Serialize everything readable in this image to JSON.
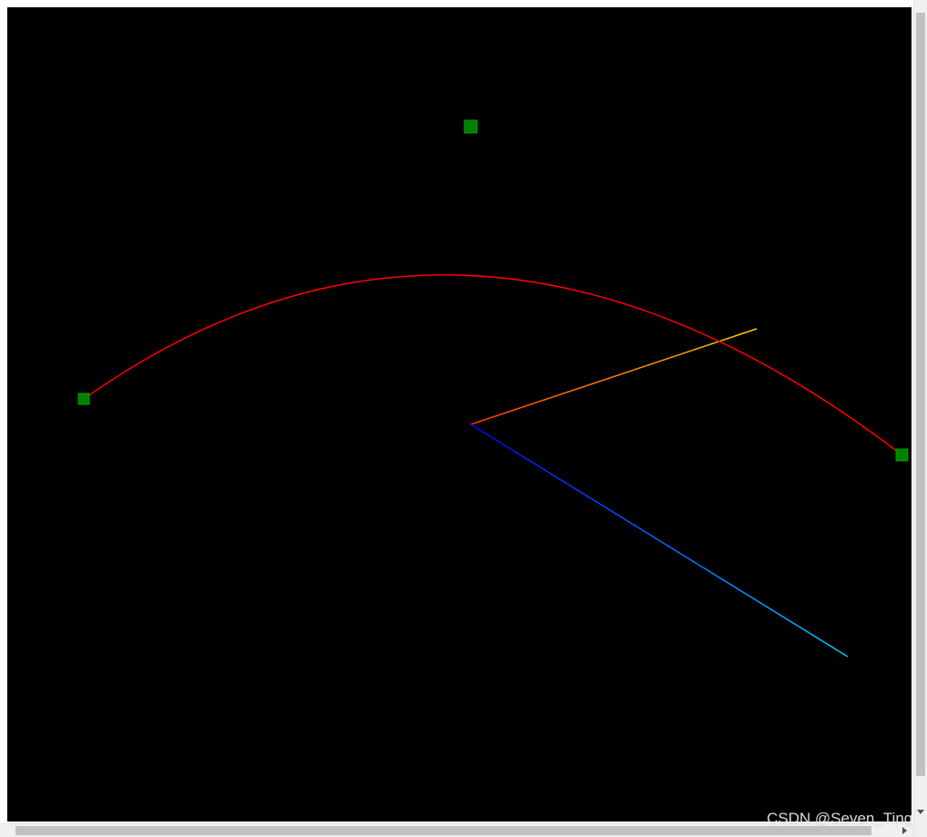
{
  "watermark": "CSDN @Seven_Ting",
  "colors": {
    "background": "#000000",
    "arc": "#ff0000",
    "control_point": "#008000",
    "axis_y_start": "#22cc22",
    "axis_y_end": "#ffff00",
    "axis_x_start": "#ff3300",
    "axis_x_end": "#ffcc00",
    "axis_z_start": "#0000ff",
    "axis_z_end": "#00ccff"
  },
  "icons": {
    "scroll_down": "chevron-down-icon",
    "scroll_right": "chevron-right-icon"
  }
}
